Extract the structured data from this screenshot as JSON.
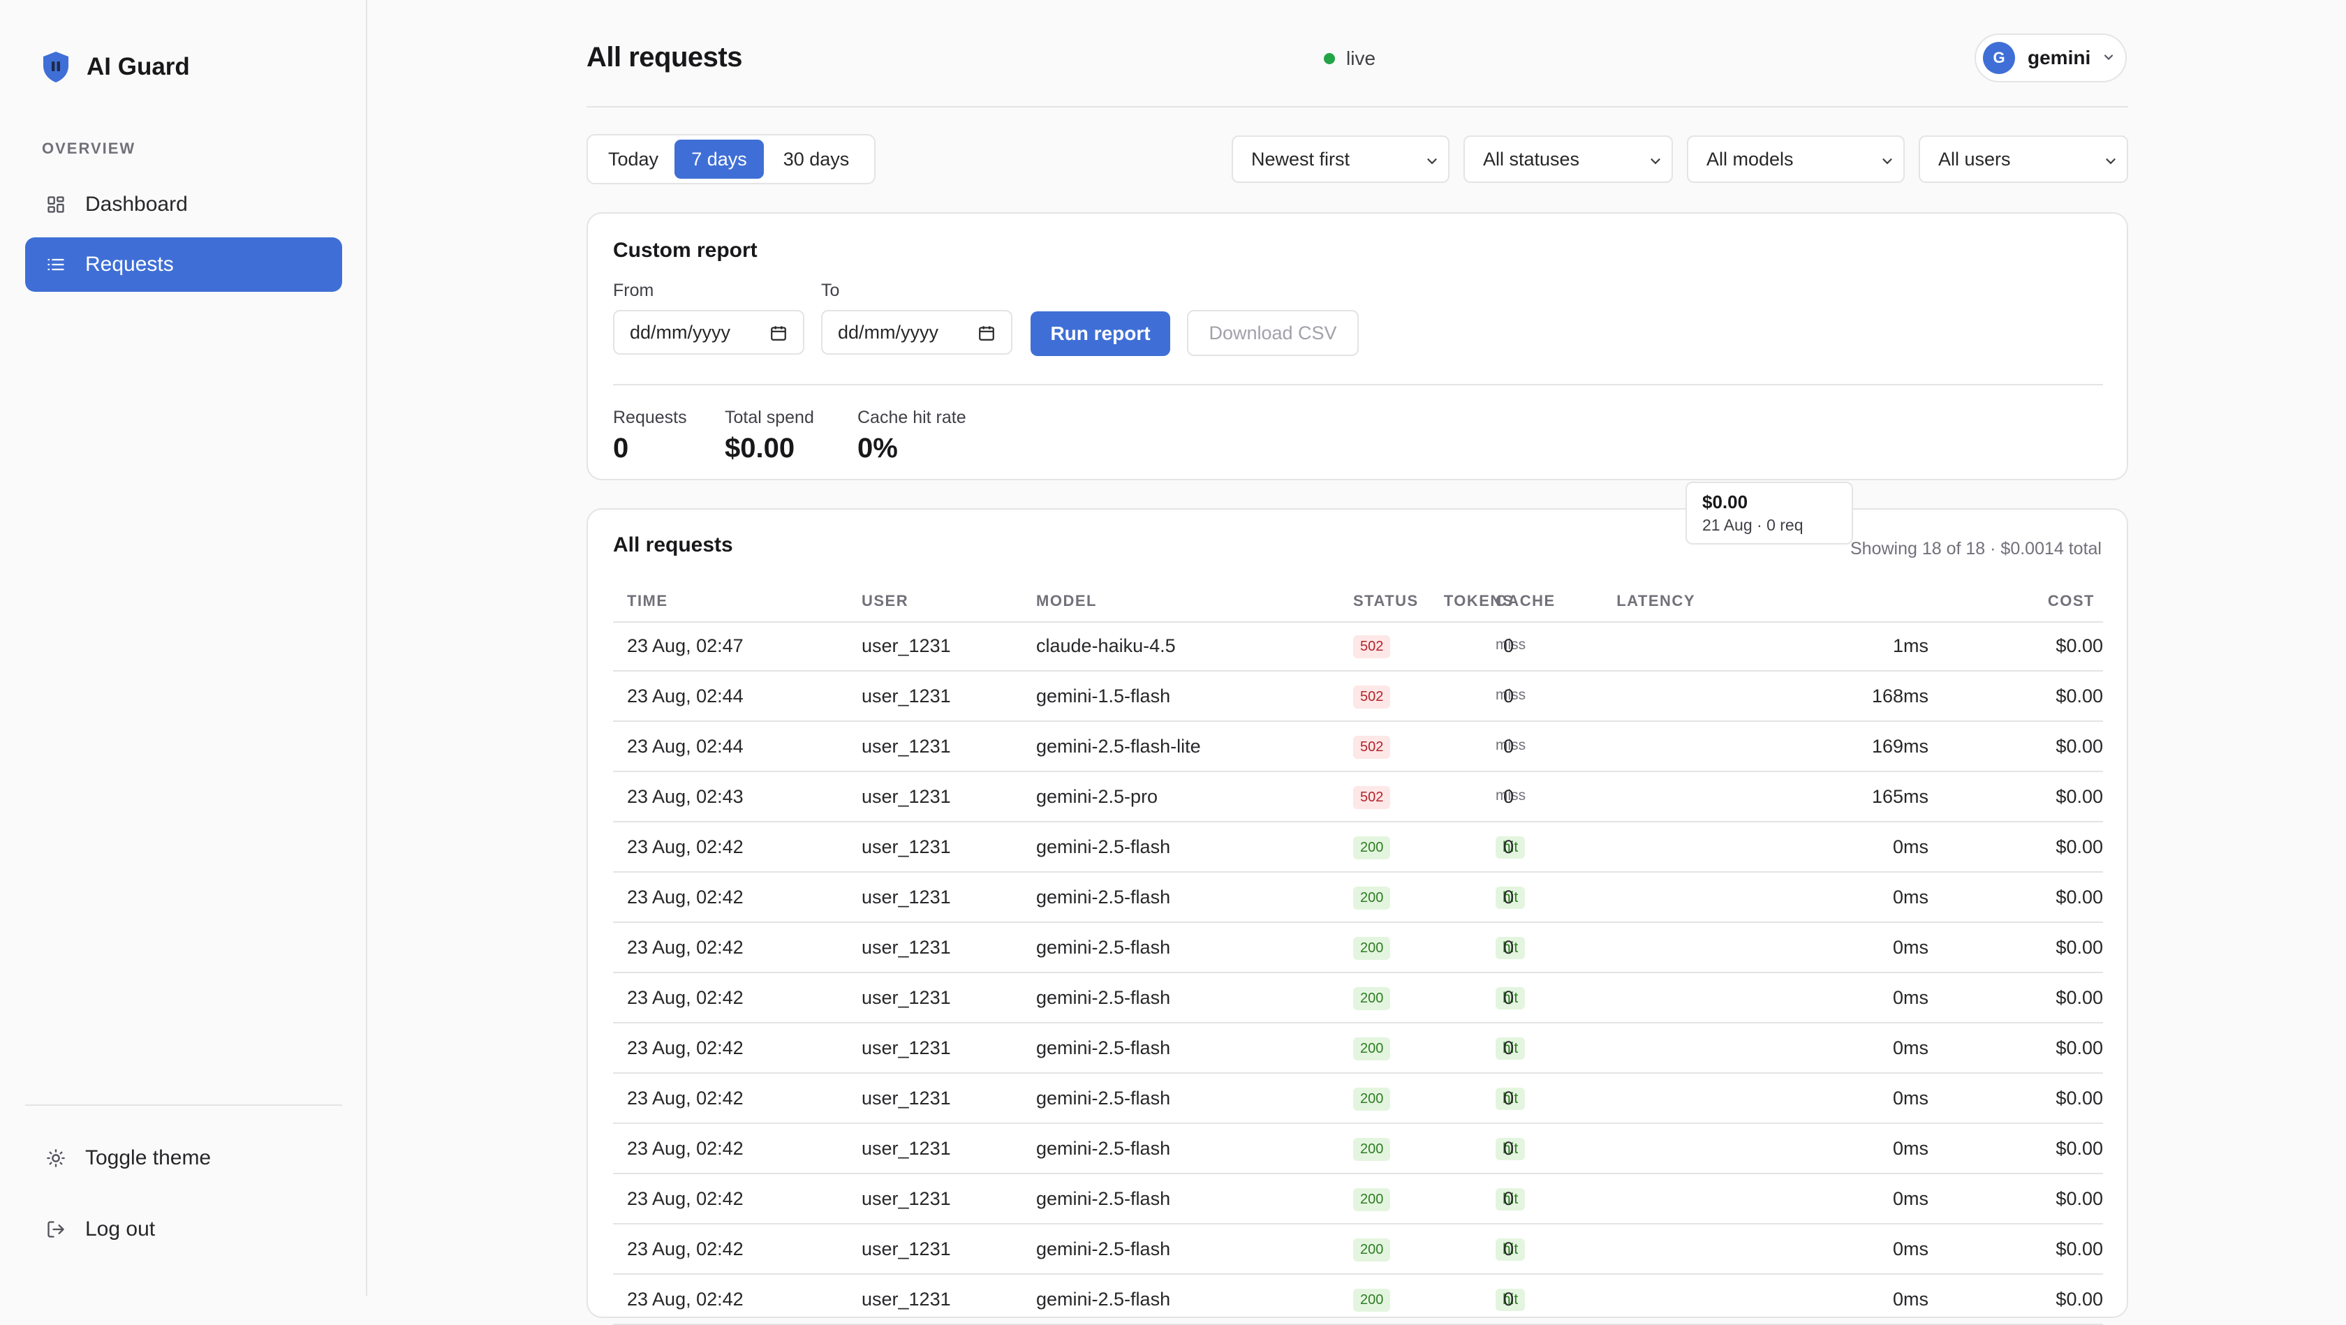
{
  "app": {
    "name": "AI Guard"
  },
  "sidebar": {
    "section_label": "OVERVIEW",
    "items": [
      {
        "label": "Dashboard",
        "icon": "grid-icon"
      },
      {
        "label": "Requests",
        "icon": "list-icon",
        "active": true
      }
    ],
    "footer": [
      {
        "label": "Toggle theme",
        "icon": "sun-icon"
      },
      {
        "label": "Log out",
        "icon": "logout-icon"
      }
    ]
  },
  "header": {
    "title": "All requests",
    "live_label": "live",
    "user": {
      "initial": "G",
      "name": "gemini"
    }
  },
  "filters": {
    "ranges": [
      "Today",
      "7 days",
      "30 days"
    ],
    "active_range": "7 days",
    "sort": "Newest first",
    "status": "All statuses",
    "model": "All models",
    "user": "All users"
  },
  "report": {
    "title": "Custom report",
    "from_label": "From",
    "to_label": "To",
    "from_placeholder": "dd/mm/yyyy",
    "to_placeholder": "dd/mm/yyyy",
    "run_label": "Run report",
    "csv_label": "Download CSV",
    "stats": [
      {
        "label": "Requests",
        "value": "0"
      },
      {
        "label": "Total spend",
        "value": "$0.00"
      },
      {
        "label": "Cache hit rate",
        "value": "0%"
      }
    ]
  },
  "tooltip": {
    "value": "$0.00",
    "sub": "21 Aug · 0 req"
  },
  "table": {
    "title": "All requests",
    "summary": "Showing 18 of 18 · $0.0014 total",
    "columns": [
      "TIME",
      "USER",
      "MODEL",
      "STATUS",
      "CACHE",
      "TOKENS",
      "LATENCY",
      "COST"
    ],
    "rows": [
      {
        "time": "23 Aug, 02:47",
        "user": "user_1231",
        "model": "claude-haiku-4.5",
        "status": "502",
        "cache": "miss",
        "tokens": "0",
        "latency": "1ms",
        "cost": "$0.00"
      },
      {
        "time": "23 Aug, 02:44",
        "user": "user_1231",
        "model": "gemini-1.5-flash",
        "status": "502",
        "cache": "miss",
        "tokens": "0",
        "latency": "168ms",
        "cost": "$0.00"
      },
      {
        "time": "23 Aug, 02:44",
        "user": "user_1231",
        "model": "gemini-2.5-flash-lite",
        "status": "502",
        "cache": "miss",
        "tokens": "0",
        "latency": "169ms",
        "cost": "$0.00"
      },
      {
        "time": "23 Aug, 02:43",
        "user": "user_1231",
        "model": "gemini-2.5-pro",
        "status": "502",
        "cache": "miss",
        "tokens": "0",
        "latency": "165ms",
        "cost": "$0.00"
      },
      {
        "time": "23 Aug, 02:42",
        "user": "user_1231",
        "model": "gemini-2.5-flash",
        "status": "200",
        "cache": "hit",
        "tokens": "0",
        "latency": "0ms",
        "cost": "$0.00"
      },
      {
        "time": "23 Aug, 02:42",
        "user": "user_1231",
        "model": "gemini-2.5-flash",
        "status": "200",
        "cache": "hit",
        "tokens": "0",
        "latency": "0ms",
        "cost": "$0.00"
      },
      {
        "time": "23 Aug, 02:42",
        "user": "user_1231",
        "model": "gemini-2.5-flash",
        "status": "200",
        "cache": "hit",
        "tokens": "0",
        "latency": "0ms",
        "cost": "$0.00"
      },
      {
        "time": "23 Aug, 02:42",
        "user": "user_1231",
        "model": "gemini-2.5-flash",
        "status": "200",
        "cache": "hit",
        "tokens": "0",
        "latency": "0ms",
        "cost": "$0.00"
      },
      {
        "time": "23 Aug, 02:42",
        "user": "user_1231",
        "model": "gemini-2.5-flash",
        "status": "200",
        "cache": "hit",
        "tokens": "0",
        "latency": "0ms",
        "cost": "$0.00"
      },
      {
        "time": "23 Aug, 02:42",
        "user": "user_1231",
        "model": "gemini-2.5-flash",
        "status": "200",
        "cache": "hit",
        "tokens": "0",
        "latency": "0ms",
        "cost": "$0.00"
      },
      {
        "time": "23 Aug, 02:42",
        "user": "user_1231",
        "model": "gemini-2.5-flash",
        "status": "200",
        "cache": "hit",
        "tokens": "0",
        "latency": "0ms",
        "cost": "$0.00"
      },
      {
        "time": "23 Aug, 02:42",
        "user": "user_1231",
        "model": "gemini-2.5-flash",
        "status": "200",
        "cache": "hit",
        "tokens": "0",
        "latency": "0ms",
        "cost": "$0.00"
      },
      {
        "time": "23 Aug, 02:42",
        "user": "user_1231",
        "model": "gemini-2.5-flash",
        "status": "200",
        "cache": "hit",
        "tokens": "0",
        "latency": "0ms",
        "cost": "$0.00"
      },
      {
        "time": "23 Aug, 02:42",
        "user": "user_1231",
        "model": "gemini-2.5-flash",
        "status": "200",
        "cache": "hit",
        "tokens": "0",
        "latency": "0ms",
        "cost": "$0.00"
      }
    ]
  },
  "colors": {
    "accent": "#3f6fd6",
    "live": "#22a447",
    "error_badge": "#b4232c",
    "ok_badge": "#2e7d24"
  }
}
